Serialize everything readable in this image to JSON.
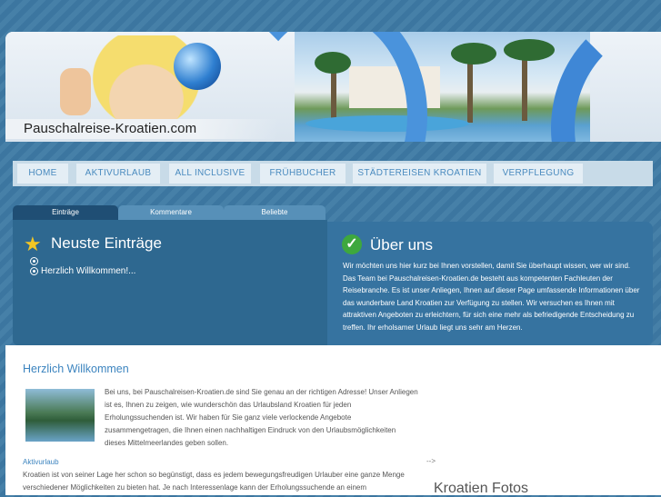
{
  "site": {
    "title": "Pauschalreise-Kroatien.com"
  },
  "nav": [
    {
      "label": "HOME"
    },
    {
      "label": "AKTIVURLAUB"
    },
    {
      "label": "ALL INCLUSIVE"
    },
    {
      "label": "FRÜHBUCHER"
    },
    {
      "label": "STÄDTEREISEN KROATIEN"
    },
    {
      "label": "VERPFLEGUNG"
    }
  ],
  "tabs": [
    {
      "label": "Einträge",
      "active": true
    },
    {
      "label": "Kommentare",
      "active": false
    },
    {
      "label": "Beliebte",
      "active": false
    }
  ],
  "left_panel": {
    "icon": "star-icon",
    "title": "Neuste Einträge",
    "entries": [
      "",
      "Herzlich Willkommen!..."
    ]
  },
  "right_panel": {
    "icon": "check-icon",
    "title": "Über uns",
    "text": "Wir möchten uns hier kurz bei Ihnen vorstellen, damit Sie überhaupt wissen, wer wir sind. Das Team bei Pauschalreisen-Kroatien.de besteht aus kompetenten Fachleuten der Reisebranche. Es ist unser Anliegen, Ihnen auf dieser Page umfassende Informationen über das wunderbare Land Kroatien zur Verfügung zu stellen. Wir versuchen es Ihnen mit attraktiven Angeboten zu erleichtern, für sich eine mehr als befriedigende Entscheidung zu treffen. Ihr erholsamer Urlaub liegt uns sehr am Herzen."
  },
  "content": {
    "title": "Herzlich Willkommen",
    "intro": "Bei uns, bei Pauschalreisen-Kroatien.de sind Sie genau an der richtigen Adresse! Unser Anliegen ist es, Ihnen zu zeigen, wie wunderschön das Urlaubsland Kroatien für jeden Erholungssuchenden ist. Wir haben für Sie ganz viele verlockende Angebote zusammengetragen, die Ihnen einen nachhaltigen Eindruck von den Urlaubsmöglichkeiten dieses Mittelmeerlandes geben sollen.",
    "subheading": "Aktivurlaub",
    "body": "Kroatien ist von seiner Lage her schon so begünstigt, dass es jedem bewegungsfreudigen Urlauber eine ganze Menge verschiedener Möglichkeiten zu bieten hat. Je nach Interessenlage kann der Erholungssuchende an einem",
    "arrow": "-->",
    "sidebar_title": "Kroatien Fotos"
  },
  "colors": {
    "accent": "#3c84bf",
    "panel_dark": "#2e6890",
    "panel_light": "#3673a0",
    "nav_bg": "#c8dbe8"
  }
}
